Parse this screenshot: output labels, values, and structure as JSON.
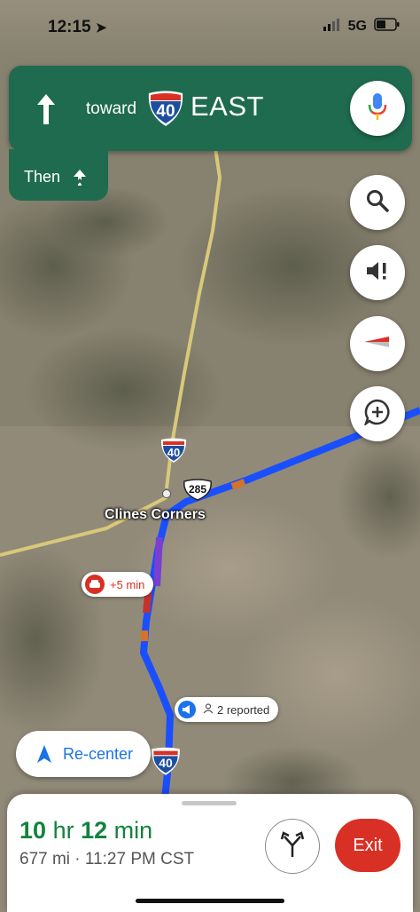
{
  "status_bar": {
    "time": "12:15",
    "network": "5G",
    "location_arrow_icon": "location-arrow-icon"
  },
  "nav": {
    "direction_icon": "straight-arrow-icon",
    "toward": "toward",
    "shield_number": "40",
    "direction": "EAST",
    "then": "Then",
    "then_icon": "merge-arrow-icon"
  },
  "map": {
    "place_label": "Clines Corners",
    "shield_40_a": "40",
    "shield_285": "285",
    "shield_40_b": "40",
    "delay_label": "+5 min",
    "report_label": "2 reported"
  },
  "buttons": {
    "recenter": "Re-center",
    "exit": "Exit"
  },
  "trip": {
    "hours": "10",
    "hr_unit": "hr",
    "minutes": "12",
    "min_unit": "min",
    "distance_eta": "677 mi · 11:27 PM CST"
  },
  "colors": {
    "nav_green": "#1f6b4f",
    "route_blue": "#1a4fff",
    "exit_red": "#d93025",
    "eta_green": "#13833c"
  }
}
